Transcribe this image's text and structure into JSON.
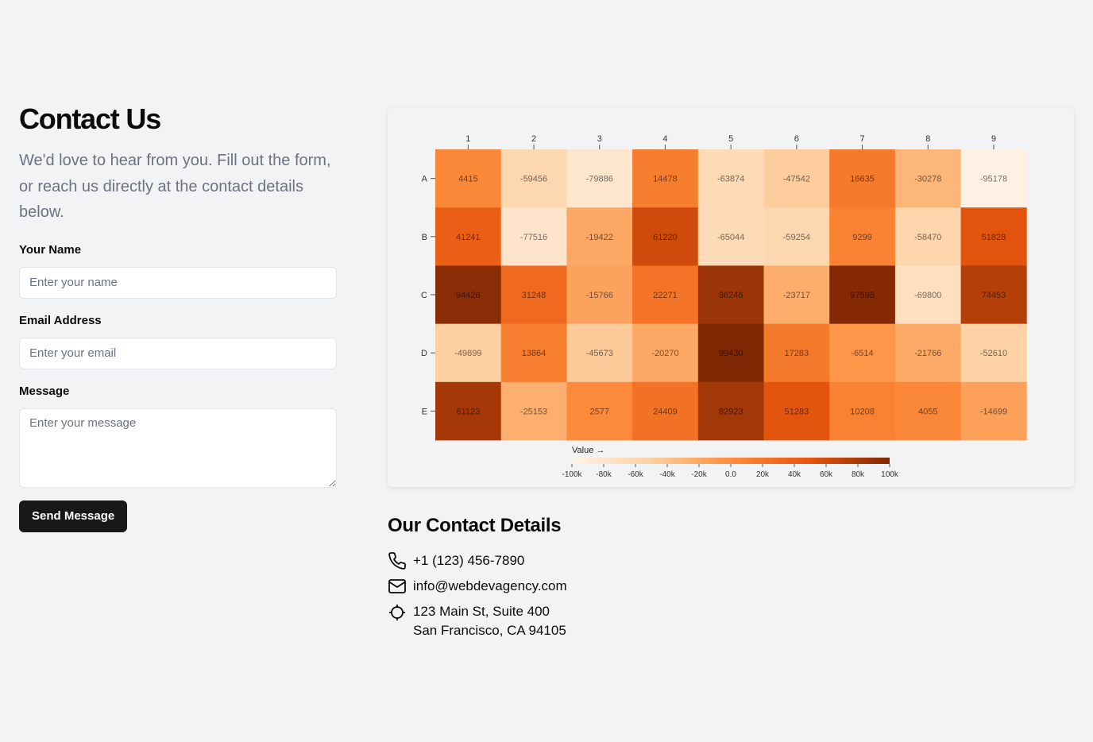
{
  "contact": {
    "title": "Contact Us",
    "intro": "We'd love to hear from you. Fill out the form, or reach us directly at the contact details below.",
    "name_label": "Your Name",
    "name_placeholder": "Enter your name",
    "email_label": "Email Address",
    "email_placeholder": "Enter your email",
    "message_label": "Message",
    "message_placeholder": "Enter your message",
    "send_label": "Send Message"
  },
  "details": {
    "title": "Our Contact Details",
    "phone": "+1 (123) 456-7890",
    "email": "info@webdevagency.com",
    "address_line1": "123 Main St, Suite 400",
    "address_line2": "San Francisco, CA 94105",
    "icons": [
      "phone-icon",
      "mail-icon",
      "crosshair-icon"
    ]
  },
  "chart_data": {
    "type": "heatmap",
    "columns": [
      "1",
      "2",
      "3",
      "4",
      "5",
      "6",
      "7",
      "8",
      "9"
    ],
    "rows": [
      "A",
      "B",
      "C",
      "D",
      "E"
    ],
    "values": [
      [
        4415,
        -59456,
        -79886,
        14478,
        -63874,
        -47542,
        16635,
        -30278,
        -95178
      ],
      [
        41241,
        -77516,
        -19422,
        61220,
        -65044,
        -59254,
        9299,
        -58470,
        51828
      ],
      [
        94426,
        31248,
        -15766,
        22271,
        86246,
        -23717,
        97595,
        -69800,
        74453
      ],
      [
        -49899,
        13864,
        -45673,
        -20270,
        99430,
        17283,
        -6514,
        -21766,
        -52610
      ],
      [
        81123,
        -25153,
        2577,
        24409,
        82923,
        51283,
        10208,
        4055,
        -14699
      ]
    ],
    "legend_title": "Value →",
    "legend_ticks": [
      "-100k",
      "-80k",
      "-60k",
      "-40k",
      "-20k",
      "0.0",
      "20k",
      "40k",
      "60k",
      "80k",
      "100k"
    ],
    "range": [
      -100000,
      100000
    ],
    "colors": [
      "#fff5eb",
      "#fdd0a2",
      "#fd8d3c",
      "#e6550d",
      "#7f2704"
    ]
  }
}
